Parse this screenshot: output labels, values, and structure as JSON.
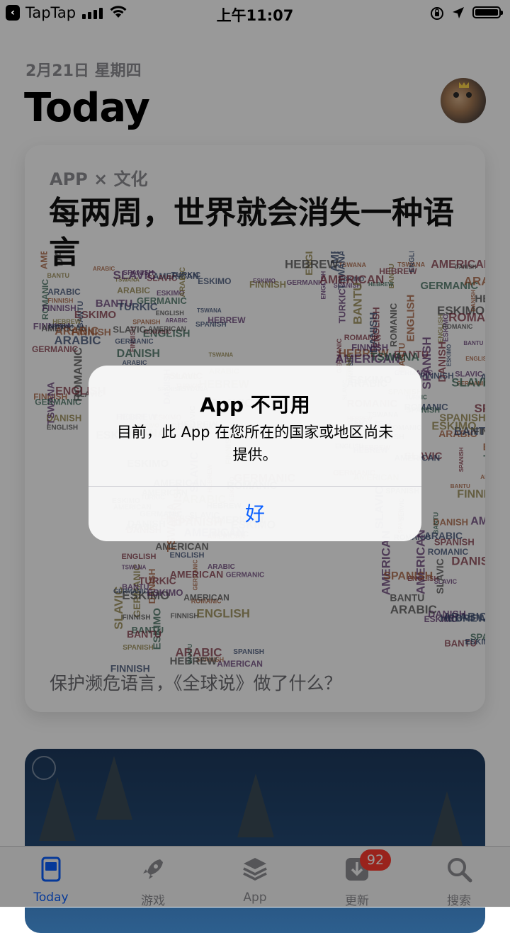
{
  "status_bar": {
    "back_app": "TapTap",
    "time": "上午11:07"
  },
  "today": {
    "date": "2月21日 星期四",
    "title": "Today"
  },
  "story_card": {
    "eyebrow": "APP × 文化",
    "title": "每两周，世界就会消失一种语言",
    "subtitle": "保护濒危语言，《全球说》做了什么？",
    "map_words": [
      "ESKIMO",
      "GERMANIC",
      "AMERICAN",
      "ENGLISH",
      "SPANISH",
      "SLAVIC",
      "TURKIC",
      "ARABIC",
      "BANTU",
      "TSWANA",
      "DANISH",
      "HEBREW",
      "ROMANIC",
      "FINNISH"
    ]
  },
  "tab_bar": {
    "tabs": [
      {
        "label": "Today",
        "icon": "today-icon",
        "active": true
      },
      {
        "label": "游戏",
        "icon": "rocket-icon",
        "active": false
      },
      {
        "label": "App",
        "icon": "layers-icon",
        "active": false
      },
      {
        "label": "更新",
        "icon": "download-icon",
        "active": false,
        "badge": "92"
      },
      {
        "label": "搜索",
        "icon": "search-icon",
        "active": false
      }
    ]
  },
  "alert": {
    "title": "App 不可用",
    "message": "目前，此 App 在您所在的国家或地区尚未提供。",
    "button_label": "好"
  },
  "colors": {
    "accent": "#0a60ff",
    "badge": "#ff3b30",
    "secondary_text": "#8e8e93"
  }
}
